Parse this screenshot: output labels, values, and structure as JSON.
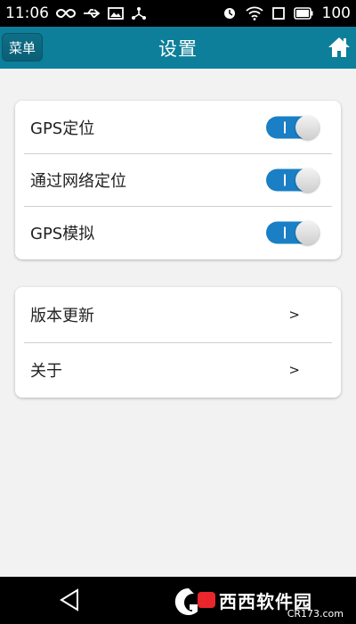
{
  "status_bar": {
    "time": "11:06",
    "battery_level": "100",
    "icons": [
      "infinity-icon",
      "usb-icon",
      "image-icon",
      "share-icon",
      "alarm-icon",
      "wifi-icon",
      "screen-icon",
      "battery-icon"
    ]
  },
  "header": {
    "menu_label": "菜单",
    "title": "设置",
    "home_icon": "home-icon",
    "color": "#0d7f9a"
  },
  "location_settings": {
    "items": [
      {
        "label": "GPS定位",
        "enabled": true
      },
      {
        "label": "通过网络定位",
        "enabled": true
      },
      {
        "label": "GPS模拟",
        "enabled": true
      }
    ]
  },
  "about_settings": {
    "items": [
      {
        "label": "版本更新",
        "chevron": ">"
      },
      {
        "label": "关于",
        "chevron": ">"
      }
    ]
  },
  "nav_bar": {
    "back_icon": "back-triangle-icon",
    "watermark": {
      "text": "西西软件园",
      "domain": "CR173.com"
    }
  },
  "colors": {
    "toggle_on": "#1a7fc4",
    "background": "#f2f2f2"
  }
}
